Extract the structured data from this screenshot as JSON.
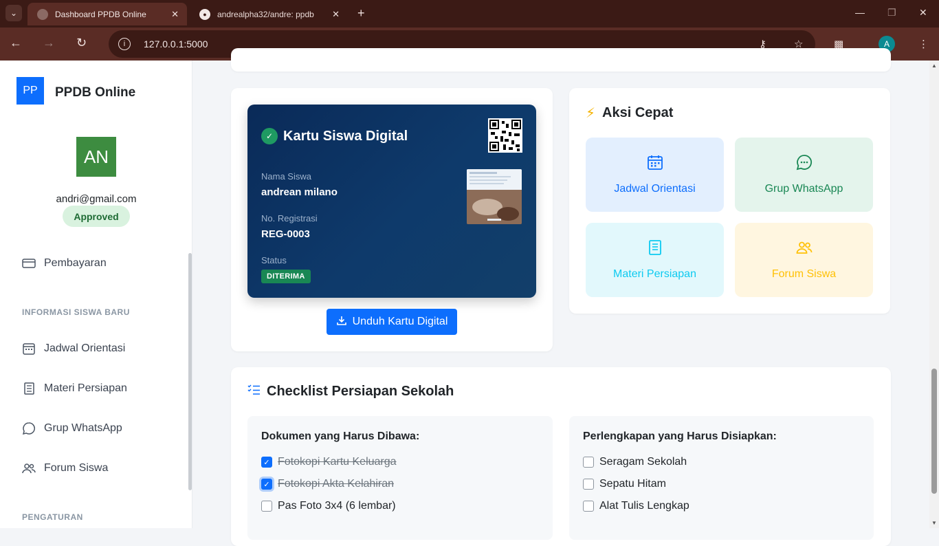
{
  "browser": {
    "tabs": [
      {
        "title": "Dashboard PPDB Online",
        "active": true
      },
      {
        "title": "andrealpha32/andre: ppdb",
        "active": false
      }
    ],
    "url": "127.0.0.1:5000",
    "profile_initial": "A"
  },
  "sidebar": {
    "logo_initials": "PP",
    "app_name": "PPDB Online",
    "avatar_initials": "AN",
    "email": "andri@gmail.com",
    "status_badge": "Approved",
    "payment_label": "Pembayaran",
    "section_info": "INFORMASI SISWA BARU",
    "items": [
      {
        "label": "Jadwal Orientasi",
        "icon": "calendar-icon"
      },
      {
        "label": "Materi Persiapan",
        "icon": "book-icon"
      },
      {
        "label": "Grup WhatsApp",
        "icon": "whatsapp-icon"
      },
      {
        "label": "Forum Siswa",
        "icon": "people-icon"
      }
    ],
    "section_settings": "PENGATURAN"
  },
  "student_card": {
    "title": "Kartu Siswa Digital",
    "name_label": "Nama Siswa",
    "name": "andrean milano",
    "reg_label": "No. Registrasi",
    "reg_no": "REG-0003",
    "status_label": "Status",
    "status": "DITERIMA",
    "download_label": "Unduh Kartu Digital"
  },
  "quick_actions": {
    "title": "Aksi Cepat",
    "tiles": [
      {
        "label": "Jadwal Orientasi",
        "icon": "calendar-icon",
        "color": "#0d6efd",
        "bg": "#e3effe"
      },
      {
        "label": "Grup WhatsApp",
        "icon": "chat-icon",
        "color": "#198754",
        "bg": "#e4f4ec"
      },
      {
        "label": "Materi Persiapan",
        "icon": "book-icon",
        "color": "#0dcaf0",
        "bg": "#e2f8fc"
      },
      {
        "label": "Forum Siswa",
        "icon": "people-icon",
        "color": "#ffc107",
        "bg": "#fff6e0"
      }
    ]
  },
  "checklist": {
    "title": "Checklist Persiapan Sekolah",
    "documents": {
      "heading": "Dokumen yang Harus Dibawa:",
      "items": [
        {
          "label": "Fotokopi Kartu Keluarga",
          "checked": true
        },
        {
          "label": "Fotokopi Akta Kelahiran",
          "checked": true
        },
        {
          "label": "Pas Foto 3x4 (6 lembar)",
          "checked": false
        }
      ]
    },
    "equipment": {
      "heading": "Perlengkapan yang Harus Disiapkan:",
      "items": [
        {
          "label": "Seragam Sekolah",
          "checked": false
        },
        {
          "label": "Sepatu Hitam",
          "checked": false
        },
        {
          "label": "Alat Tulis Lengkap",
          "checked": false
        }
      ]
    }
  }
}
